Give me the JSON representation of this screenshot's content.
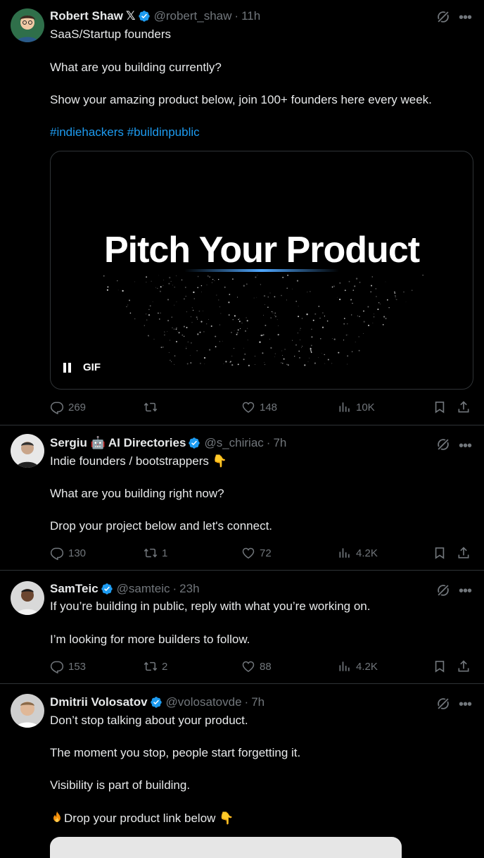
{
  "tweets": [
    {
      "name": "Robert Shaw",
      "x_badge": "𝕏",
      "handle": "@robert_shaw",
      "time": "11h",
      "lines": [
        "SaaS/Startup founders",
        "What are you building currently?",
        "Show your amazing product below, join 100+ founders here every week."
      ],
      "hashtags": "#indiehackers #buildinpublic",
      "media": {
        "title": "Pitch Your Product",
        "gif_label": "GIF"
      },
      "stats": {
        "replies": "269",
        "reposts": "",
        "likes": "148",
        "views": "10K"
      }
    },
    {
      "name": "Sergiu 🤖 AI Directories",
      "handle": "@s_chiriac",
      "time": "7h",
      "lines": [
        "Indie founders / bootstrappers 👇",
        "What are you building right now?",
        "Drop your project below and let's connect."
      ],
      "stats": {
        "replies": "130",
        "reposts": "1",
        "likes": "72",
        "views": "4.2K"
      }
    },
    {
      "name": "SamTeic",
      "handle": "@samteic",
      "time": "23h",
      "lines": [
        "If you’re building in public, reply with what you’re working on.",
        "I’m looking for more builders to follow."
      ],
      "stats": {
        "replies": "153",
        "reposts": "2",
        "likes": "88",
        "views": "4.2K"
      }
    },
    {
      "name": "Dmitrii Volosatov",
      "handle": "@volosatovde",
      "time": "7h",
      "lines": [
        "Don’t stop talking about your product.",
        "The moment you stop, people start forgetting it.",
        "Visibility is part of building.",
        "Drop your product link below 👇"
      ]
    }
  ],
  "colors": {
    "background": "#000000",
    "text": "#e7e9ea",
    "muted": "#71767b",
    "accent": "#1d9bf0",
    "divider": "#2f3336"
  },
  "icons": [
    "verified-badge-icon",
    "grok-icon",
    "more-icon",
    "reply-icon",
    "repost-icon",
    "like-icon",
    "views-icon",
    "bookmark-icon",
    "share-icon",
    "pause-icon",
    "fire-icon"
  ]
}
